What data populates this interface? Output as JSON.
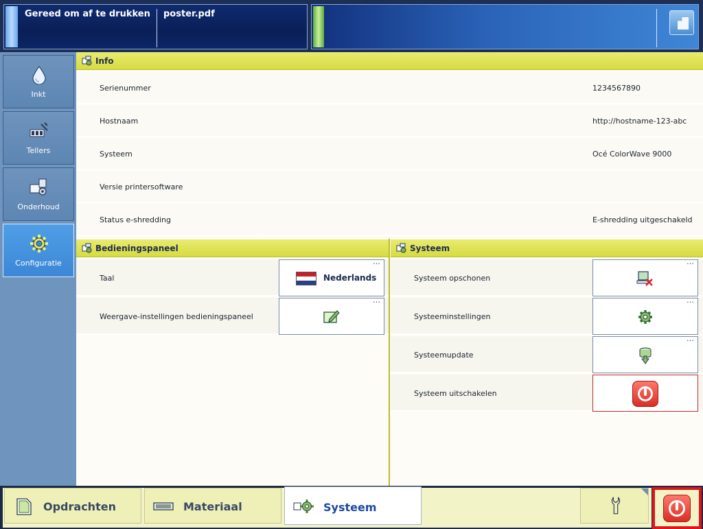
{
  "status": {
    "state_text": "Gereed om af te drukken",
    "file_name": "poster.pdf"
  },
  "nav": {
    "items": [
      {
        "label": "Inkt",
        "icon": "ink-drop-icon"
      },
      {
        "label": "Tellers",
        "icon": "counters-icon"
      },
      {
        "label": "Onderhoud",
        "icon": "maintenance-icon"
      },
      {
        "label": "Configuratie",
        "icon": "gear-icon",
        "active": true
      }
    ]
  },
  "info": {
    "title": "Info",
    "rows": [
      {
        "label": "Serienummer",
        "value": "1234567890"
      },
      {
        "label": "Hostnaam",
        "value": "http://hostname-123-abc"
      },
      {
        "label": "Systeem",
        "value": "Océ ColorWave 9000"
      },
      {
        "label": "Versie printersoftware",
        "value": ""
      },
      {
        "label": "Status e-shredding",
        "value": "E-shredding uitgeschakeld"
      }
    ]
  },
  "control_panel": {
    "title": "Bedieningspaneel",
    "rows": [
      {
        "label": "Taal",
        "button_text": "Nederlands",
        "icon": "dutch-flag-icon"
      },
      {
        "label": "Weergave-instellingen bedieningspaneel",
        "button_text": "",
        "icon": "edit-display-icon"
      }
    ]
  },
  "system": {
    "title": "Systeem",
    "rows": [
      {
        "label": "Systeem opschonen",
        "icon": "cleanup-icon"
      },
      {
        "label": "Systeeminstellingen",
        "icon": "settings-gear-icon"
      },
      {
        "label": "Systeemupdate",
        "icon": "update-icon"
      },
      {
        "label": "Systeem uitschakelen",
        "icon": "power-icon"
      }
    ]
  },
  "tabs": [
    {
      "label": "Opdrachten",
      "icon": "jobs-icon"
    },
    {
      "label": "Materiaal",
      "icon": "media-icon"
    },
    {
      "label": "Systeem",
      "icon": "system-gears-icon",
      "active": true
    }
  ],
  "colors": {
    "header_yellow": "#d7db41",
    "active_nav": "#3c87d6",
    "power_red": "#d92c22"
  }
}
